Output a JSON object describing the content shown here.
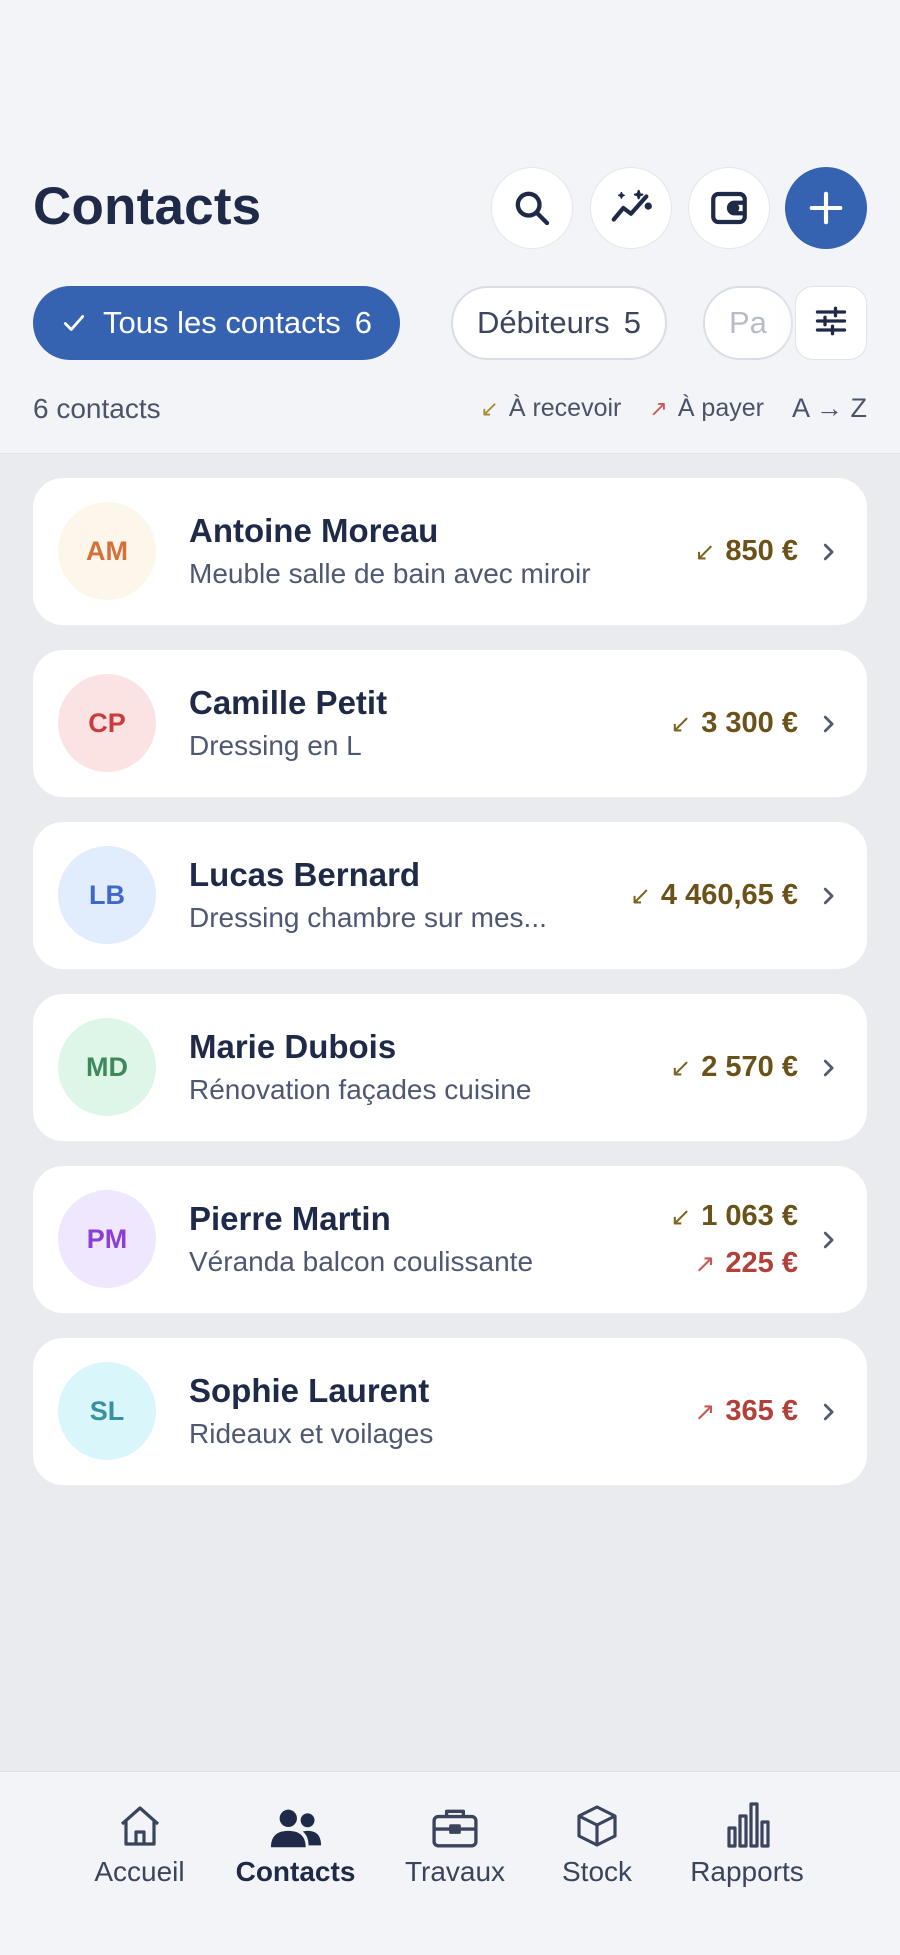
{
  "header": {
    "title": "Contacts",
    "actions": [
      {
        "id": "search",
        "icon": "search-icon"
      },
      {
        "id": "insights",
        "icon": "sparkle-chart-icon"
      },
      {
        "id": "wallet",
        "icon": "wallet-icon"
      },
      {
        "id": "add",
        "icon": "plus-icon"
      }
    ]
  },
  "filters": {
    "chips": [
      {
        "label": "Tous les contacts",
        "count": "6",
        "active": true
      },
      {
        "label": "Débiteurs",
        "count": "5",
        "active": false
      },
      {
        "label": "Pa",
        "count": "",
        "active": false
      }
    ],
    "settings_icon": "sliders-icon"
  },
  "summary": {
    "count_label": "6 contacts",
    "legend_receive": "À recevoir",
    "legend_pay": "À payer",
    "sort_label": "A → Z",
    "receive_arrow": "↙",
    "pay_arrow": "↗"
  },
  "contacts": [
    {
      "initials": "AM",
      "name": "Antoine Moreau",
      "subtitle": "Meuble salle de bain avec miroir",
      "receive": "850 €",
      "pay": "",
      "avatar_bg": "#fdf6ea",
      "avatar_fg": "#d4703a"
    },
    {
      "initials": "CP",
      "name": "Camille Petit",
      "subtitle": "Dressing en L",
      "receive": "3 300 €",
      "pay": "",
      "avatar_bg": "#fbe3e4",
      "avatar_fg": "#cc3b3b"
    },
    {
      "initials": "LB",
      "name": "Lucas Bernard",
      "subtitle": "Dressing chambre sur mes...",
      "receive": "4 460,65 €",
      "pay": "",
      "avatar_bg": "#e1ecfd",
      "avatar_fg": "#3f69c9"
    },
    {
      "initials": "MD",
      "name": "Marie Dubois",
      "subtitle": "Rénovation façades cuisine",
      "receive": "2 570 €",
      "pay": "",
      "avatar_bg": "#ddf6e7",
      "avatar_fg": "#3c8a5a"
    },
    {
      "initials": "PM",
      "name": "Pierre Martin",
      "subtitle": "Véranda balcon coulissante",
      "receive": "1 063 €",
      "pay": "225 €",
      "avatar_bg": "#efe7fd",
      "avatar_fg": "#8a3fd6"
    },
    {
      "initials": "SL",
      "name": "Sophie Laurent",
      "subtitle": "Rideaux et voilages",
      "receive": "",
      "pay": "365 €",
      "avatar_bg": "#d9f6fb",
      "avatar_fg": "#3a8fa3"
    }
  ],
  "nav": {
    "items": [
      {
        "label": "Accueil",
        "icon": "home-icon",
        "active": false
      },
      {
        "label": "Contacts",
        "icon": "people-icon",
        "active": true
      },
      {
        "label": "Travaux",
        "icon": "briefcase-icon",
        "active": false
      },
      {
        "label": "Stock",
        "icon": "box-icon",
        "active": false
      },
      {
        "label": "Rapports",
        "icon": "bar-chart-icon",
        "active": false
      }
    ]
  },
  "colors": {
    "primary": "#3563b1",
    "receive": "#6a5219",
    "pay": "#b24039",
    "text": "#1e2a47"
  }
}
